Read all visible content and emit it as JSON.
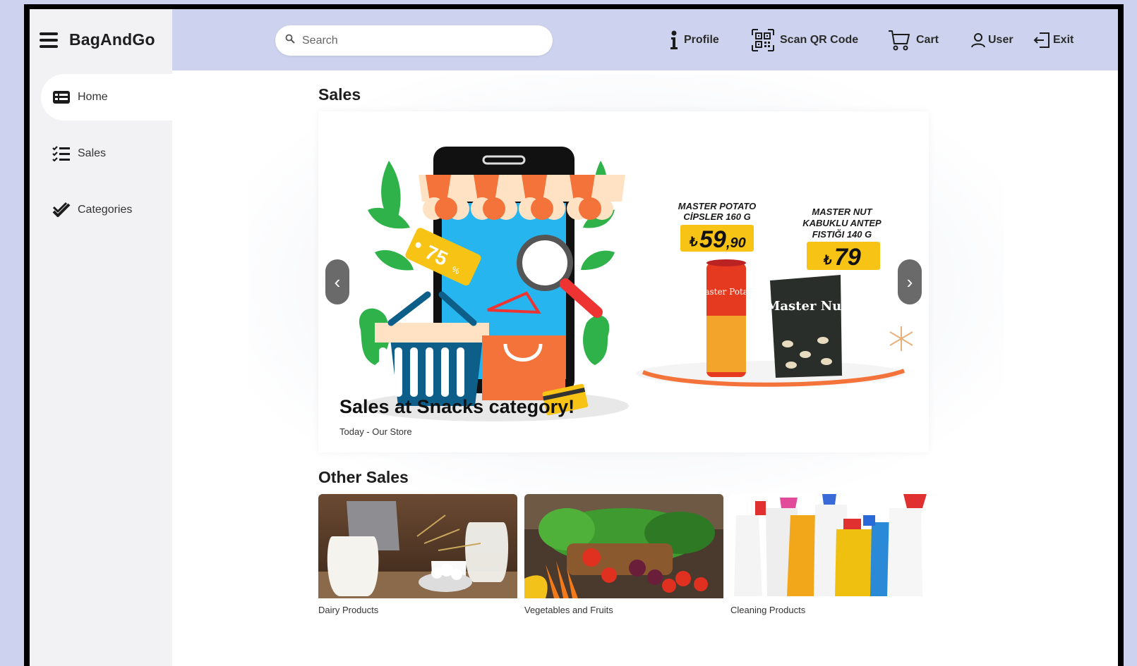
{
  "app": {
    "name": "BagAndGo"
  },
  "sidebar": {
    "items": [
      {
        "label": "Home",
        "icon": "home-list-icon",
        "active": true
      },
      {
        "label": "Sales",
        "icon": "checklist-icon"
      },
      {
        "label": "Categories",
        "icon": "double-check-icon"
      }
    ]
  },
  "header": {
    "search": {
      "placeholder": "Search",
      "value": ""
    },
    "menu": [
      {
        "label": "Profile",
        "icon": "info-icon"
      },
      {
        "label": "Scan QR Code",
        "icon": "qr-code-icon"
      },
      {
        "label": "Cart",
        "icon": "cart-icon"
      },
      {
        "label": "User",
        "icon": "user-icon"
      },
      {
        "label": "Exit",
        "icon": "exit-icon"
      }
    ]
  },
  "main": {
    "sales_title": "Sales",
    "carousel": {
      "slide_title": "Sales at Snacks category!",
      "slide_subtitle": "Today - Our Store",
      "products": [
        {
          "name": "MASTER POTATO CİPSLER 160 G",
          "price_main": "59",
          "price_cents": ",90",
          "currency": "₺",
          "package_text": "Master Potato"
        },
        {
          "name": "MASTER NUT KABUKLU ANTEP FISTIĞI 140 G",
          "price_main": "79",
          "price_cents": "",
          "currency": "₺",
          "package_text": "Master Nut"
        }
      ],
      "badge_text": "75",
      "badge_unit": "%"
    },
    "other_title": "Other Sales",
    "cards": [
      {
        "label": "Dairy Products"
      },
      {
        "label": "Vegetables and Fruits"
      },
      {
        "label": "Cleaning Products"
      }
    ]
  },
  "colors": {
    "header_bg": "#cdd3ee",
    "sidebar_bg": "#f2f2f4",
    "price_tag": "#f7c416",
    "awning_orange": "#f4733a",
    "phone_screen": "#26b5ef"
  }
}
